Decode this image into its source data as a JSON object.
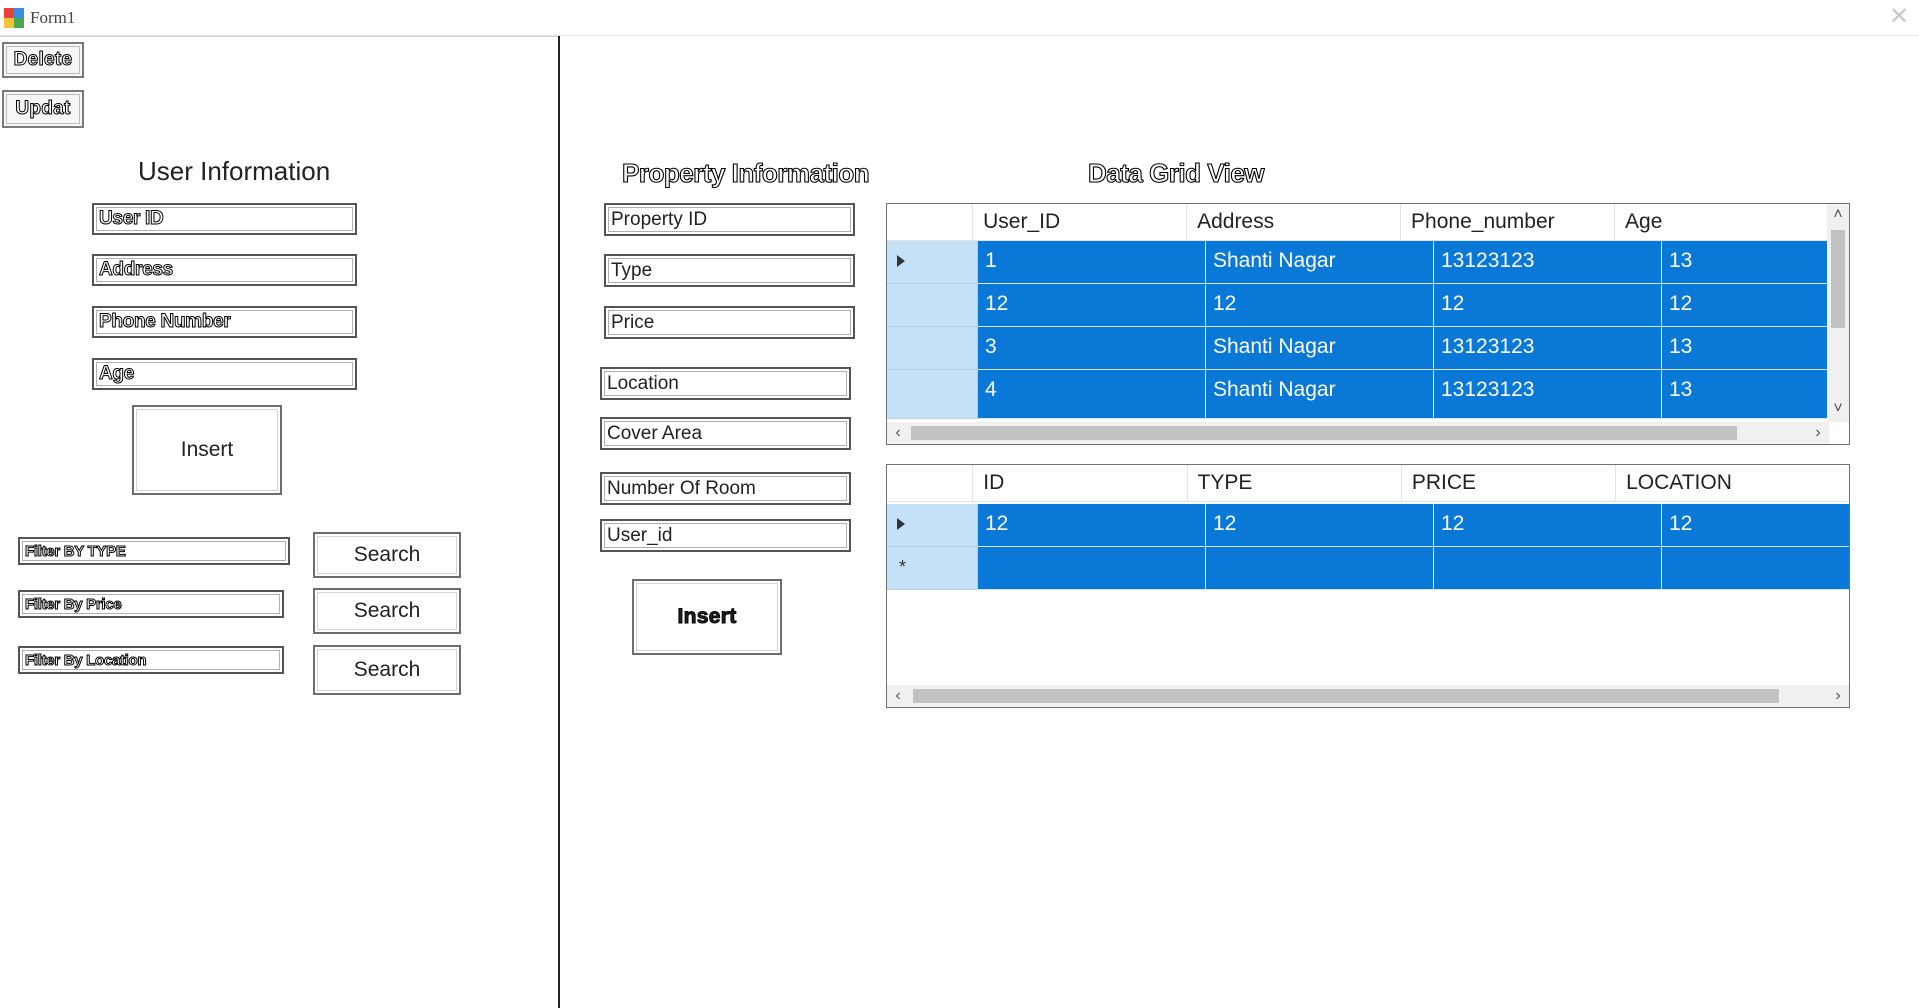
{
  "window": {
    "title": "Form1"
  },
  "toolbar": {
    "delete_label": "Delete",
    "update_label": "Updat"
  },
  "user_info": {
    "heading": "User Information",
    "fields": [
      "User ID",
      "Address",
      "Phone Number",
      "Age"
    ],
    "insert_label": "Insert"
  },
  "filters": [
    {
      "text": "Filter BY TYPE",
      "button": "Search"
    },
    {
      "text": "Filter By Price",
      "button": "Search"
    },
    {
      "text": "Filter By Location",
      "button": "Search"
    }
  ],
  "property_info": {
    "heading": "Property Information",
    "fields": [
      "Property ID",
      "Type",
      "Price",
      "Location",
      "Cover Area",
      "Number Of Room",
      "User_id"
    ],
    "insert_label": "Insert"
  },
  "grid_heading": "Data Grid View",
  "users_grid": {
    "columns": [
      "User_ID",
      "Address",
      "Phone_number",
      "Age"
    ],
    "rows": [
      [
        "1",
        "Shanti Nagar",
        "13123123",
        "13"
      ],
      [
        "12",
        "12",
        "12",
        "12"
      ],
      [
        "3",
        "Shanti Nagar",
        "13123123",
        "13"
      ],
      [
        "4",
        "Shanti Nagar",
        "13123123",
        "13"
      ]
    ]
  },
  "property_grid": {
    "columns": [
      "ID",
      "TYPE",
      "PRICE",
      "LOCATION"
    ],
    "rows": [
      [
        "12",
        "12",
        "12",
        "12"
      ],
      [
        "",
        "",
        "",
        ""
      ]
    ]
  },
  "colors": {
    "selection": "#0a78d7",
    "row_header": "#c5e1f7",
    "divider": "#222222"
  }
}
